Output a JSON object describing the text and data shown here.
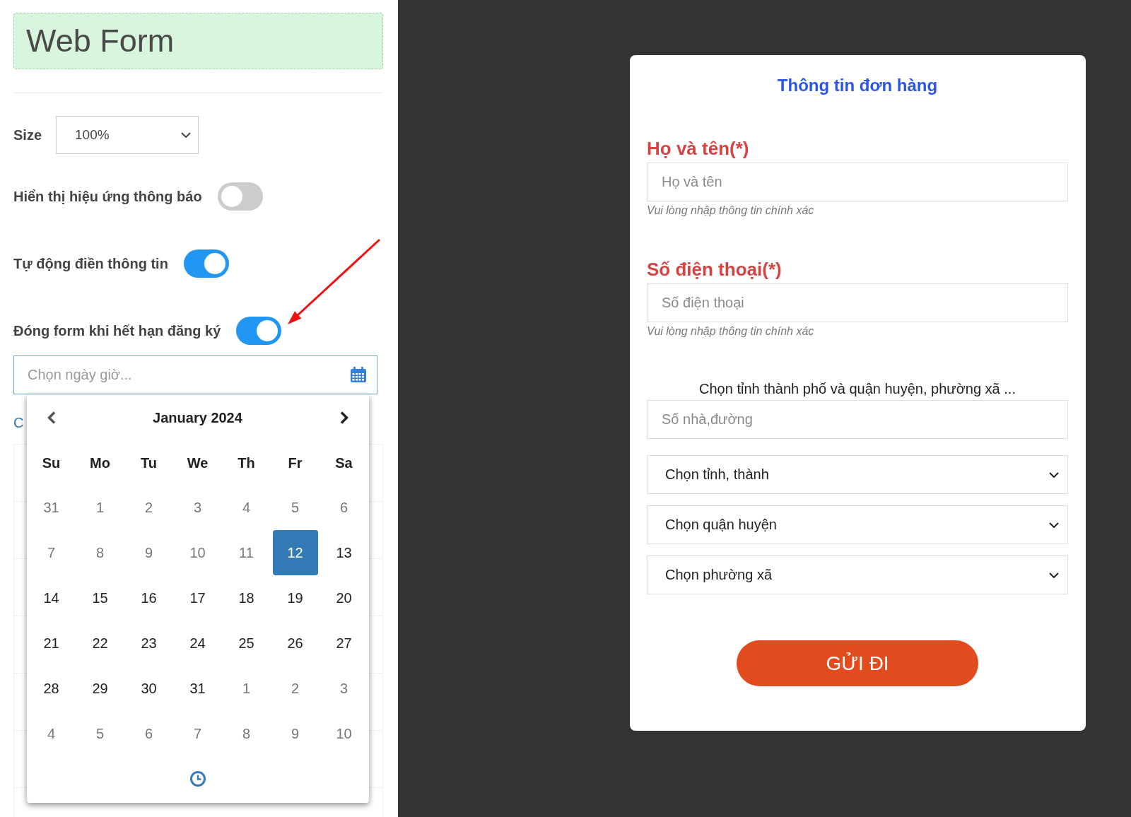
{
  "header": {
    "title": "Web Form"
  },
  "settings": {
    "size": {
      "label": "Size",
      "value": "100%"
    },
    "toggles": [
      {
        "label": "Hiển thị hiệu ứng thông báo",
        "on": false
      },
      {
        "label": "Tự động điền thông tin",
        "on": true
      },
      {
        "label": "Đóng form khi hết hạn đăng ký",
        "on": true
      }
    ]
  },
  "date_field": {
    "placeholder": "Chọn ngày giờ..."
  },
  "link": {
    "text": "C"
  },
  "datepicker": {
    "title": "January 2024",
    "weekdays": [
      "Su",
      "Mo",
      "Tu",
      "We",
      "Th",
      "Fr",
      "Sa"
    ],
    "days": [
      {
        "label": "31",
        "disabled": true,
        "selected": false
      },
      {
        "label": "1",
        "disabled": true,
        "selected": false
      },
      {
        "label": "2",
        "disabled": true,
        "selected": false
      },
      {
        "label": "3",
        "disabled": true,
        "selected": false
      },
      {
        "label": "4",
        "disabled": true,
        "selected": false
      },
      {
        "label": "5",
        "disabled": true,
        "selected": false
      },
      {
        "label": "6",
        "disabled": true,
        "selected": false
      },
      {
        "label": "7",
        "disabled": true,
        "selected": false
      },
      {
        "label": "8",
        "disabled": true,
        "selected": false
      },
      {
        "label": "9",
        "disabled": true,
        "selected": false
      },
      {
        "label": "10",
        "disabled": true,
        "selected": false
      },
      {
        "label": "11",
        "disabled": true,
        "selected": false
      },
      {
        "label": "12",
        "disabled": false,
        "selected": true
      },
      {
        "label": "13",
        "disabled": false,
        "selected": false
      },
      {
        "label": "14",
        "disabled": false,
        "selected": false
      },
      {
        "label": "15",
        "disabled": false,
        "selected": false
      },
      {
        "label": "16",
        "disabled": false,
        "selected": false
      },
      {
        "label": "17",
        "disabled": false,
        "selected": false
      },
      {
        "label": "18",
        "disabled": false,
        "selected": false
      },
      {
        "label": "19",
        "disabled": false,
        "selected": false
      },
      {
        "label": "20",
        "disabled": false,
        "selected": false
      },
      {
        "label": "21",
        "disabled": false,
        "selected": false
      },
      {
        "label": "22",
        "disabled": false,
        "selected": false
      },
      {
        "label": "23",
        "disabled": false,
        "selected": false
      },
      {
        "label": "24",
        "disabled": false,
        "selected": false
      },
      {
        "label": "25",
        "disabled": false,
        "selected": false
      },
      {
        "label": "26",
        "disabled": false,
        "selected": false
      },
      {
        "label": "27",
        "disabled": false,
        "selected": false
      },
      {
        "label": "28",
        "disabled": false,
        "selected": false
      },
      {
        "label": "29",
        "disabled": false,
        "selected": false
      },
      {
        "label": "30",
        "disabled": false,
        "selected": false
      },
      {
        "label": "31",
        "disabled": false,
        "selected": false
      },
      {
        "label": "1",
        "disabled": true,
        "selected": false
      },
      {
        "label": "2",
        "disabled": true,
        "selected": false
      },
      {
        "label": "3",
        "disabled": true,
        "selected": false
      },
      {
        "label": "4",
        "disabled": true,
        "selected": false
      },
      {
        "label": "5",
        "disabled": true,
        "selected": false
      },
      {
        "label": "6",
        "disabled": true,
        "selected": false
      },
      {
        "label": "7",
        "disabled": true,
        "selected": false
      },
      {
        "label": "8",
        "disabled": true,
        "selected": false
      },
      {
        "label": "9",
        "disabled": true,
        "selected": false
      },
      {
        "label": "10",
        "disabled": true,
        "selected": false
      }
    ]
  },
  "order_form": {
    "title": "Thông tin đơn hàng",
    "fields": [
      {
        "label": "Họ và tên(*)",
        "placeholder": "Họ và tên",
        "hint": "Vui lòng nhập thông tin chính xác"
      },
      {
        "label": "Số điện thoại(*)",
        "placeholder": "Số điện thoại",
        "hint": "Vui lòng nhập thông tin chính xác"
      }
    ],
    "address": {
      "note": "Chọn tỉnh thành phố và quận huyện, phường xã ...",
      "inputs": [
        {
          "kind": "text",
          "placeholder": "Số nhà,đường"
        },
        {
          "kind": "select",
          "value": "Chọn tỉnh, thành"
        },
        {
          "kind": "select",
          "value": "Chọn quận huyện"
        },
        {
          "kind": "select",
          "value": "Chọn phường xã"
        }
      ]
    },
    "submit": "GỬI ĐI"
  }
}
